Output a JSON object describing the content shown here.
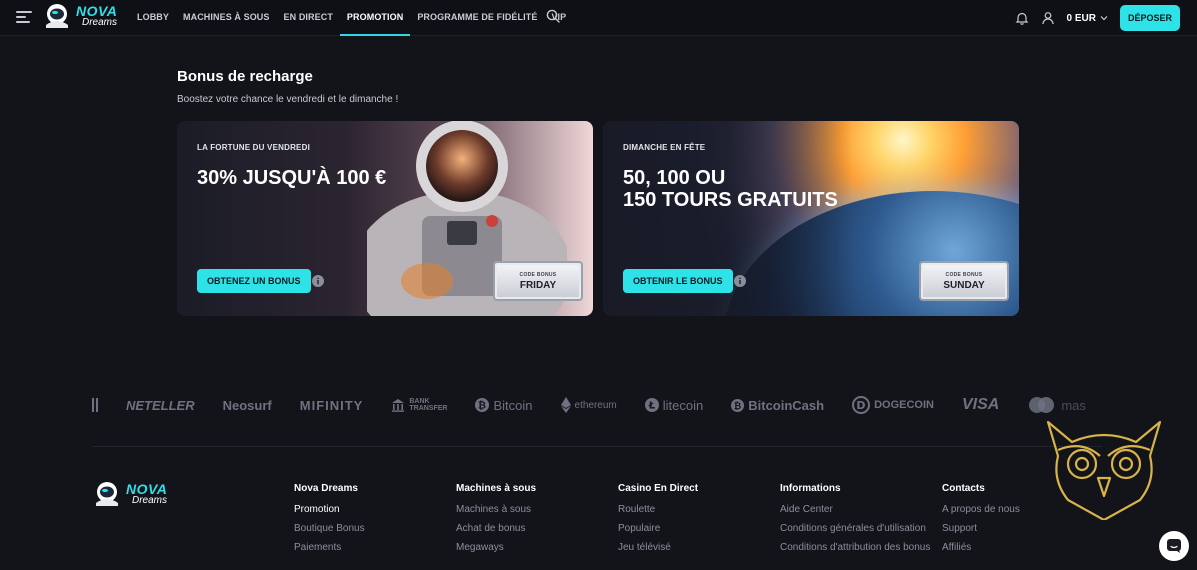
{
  "header": {
    "logo_line1": "NOVA",
    "logo_line2": "Dreams",
    "nav": [
      {
        "label": "LOBBY"
      },
      {
        "label": "MACHINES À SOUS"
      },
      {
        "label": "EN DIRECT"
      },
      {
        "label": "PROMOTION"
      },
      {
        "label": "PROGRAMME DE FIDÉLITÉ"
      },
      {
        "label": "VIP"
      }
    ],
    "balance": "0 EUR",
    "deposit_label": "DÉPOSER",
    "accent": "#2ee3e7"
  },
  "bonus": {
    "title": "Bonus de recharge",
    "subtitle": "Boostez votre chance le vendredi et le dimanche !",
    "cards": [
      {
        "label": "LA FORTUNE DU VENDREDI",
        "headline": "30% JUSQU'À 100 €",
        "button": "OBTENEZ UN BONUS",
        "code_caption": "CODE BONUS",
        "code": "FRIDAY"
      },
      {
        "label": "DIMANCHE EN FÊTE",
        "headline_1": "50, 100 OU",
        "headline_2": "150 TOURS GRATUITS",
        "button": "OBTENIR LE BONUS",
        "code_caption": "CODE BONUS",
        "code": "SUNDAY"
      }
    ]
  },
  "payments": {
    "neteller": "NETELLER",
    "neosurf": "Neosurf",
    "mifinity": "MIFINITY",
    "bank_1": "BANK",
    "bank_2": "TRANSFER",
    "bitcoin": "Bitcoin",
    "ethereum": "ethereum",
    "litecoin": "litecoin",
    "bitcoincash": "BitcoinCash",
    "dogecoin": "DOGECOIN",
    "visa": "VISA",
    "mastercard": "mas"
  },
  "footer": {
    "logo_line1": "NOVA",
    "logo_line2": "Dreams",
    "columns": [
      {
        "title": "Nova Dreams",
        "links": [
          "Promotion",
          "Boutique Bonus",
          "Paiements"
        ]
      },
      {
        "title": "Machines à sous",
        "links": [
          "Machines à sous",
          "Achat de bonus",
          "Megaways"
        ]
      },
      {
        "title": "Casino En Direct",
        "links": [
          "Roulette",
          "Populaire",
          "Jeu télévisé"
        ]
      },
      {
        "title": "Informations",
        "links": [
          "Aide Center",
          "Conditions générales d'utilisation",
          "Conditions d'attribution des bonus"
        ]
      },
      {
        "title": "Contacts",
        "links": [
          "A propos de nous",
          "Support",
          "Affiliés"
        ]
      }
    ]
  }
}
